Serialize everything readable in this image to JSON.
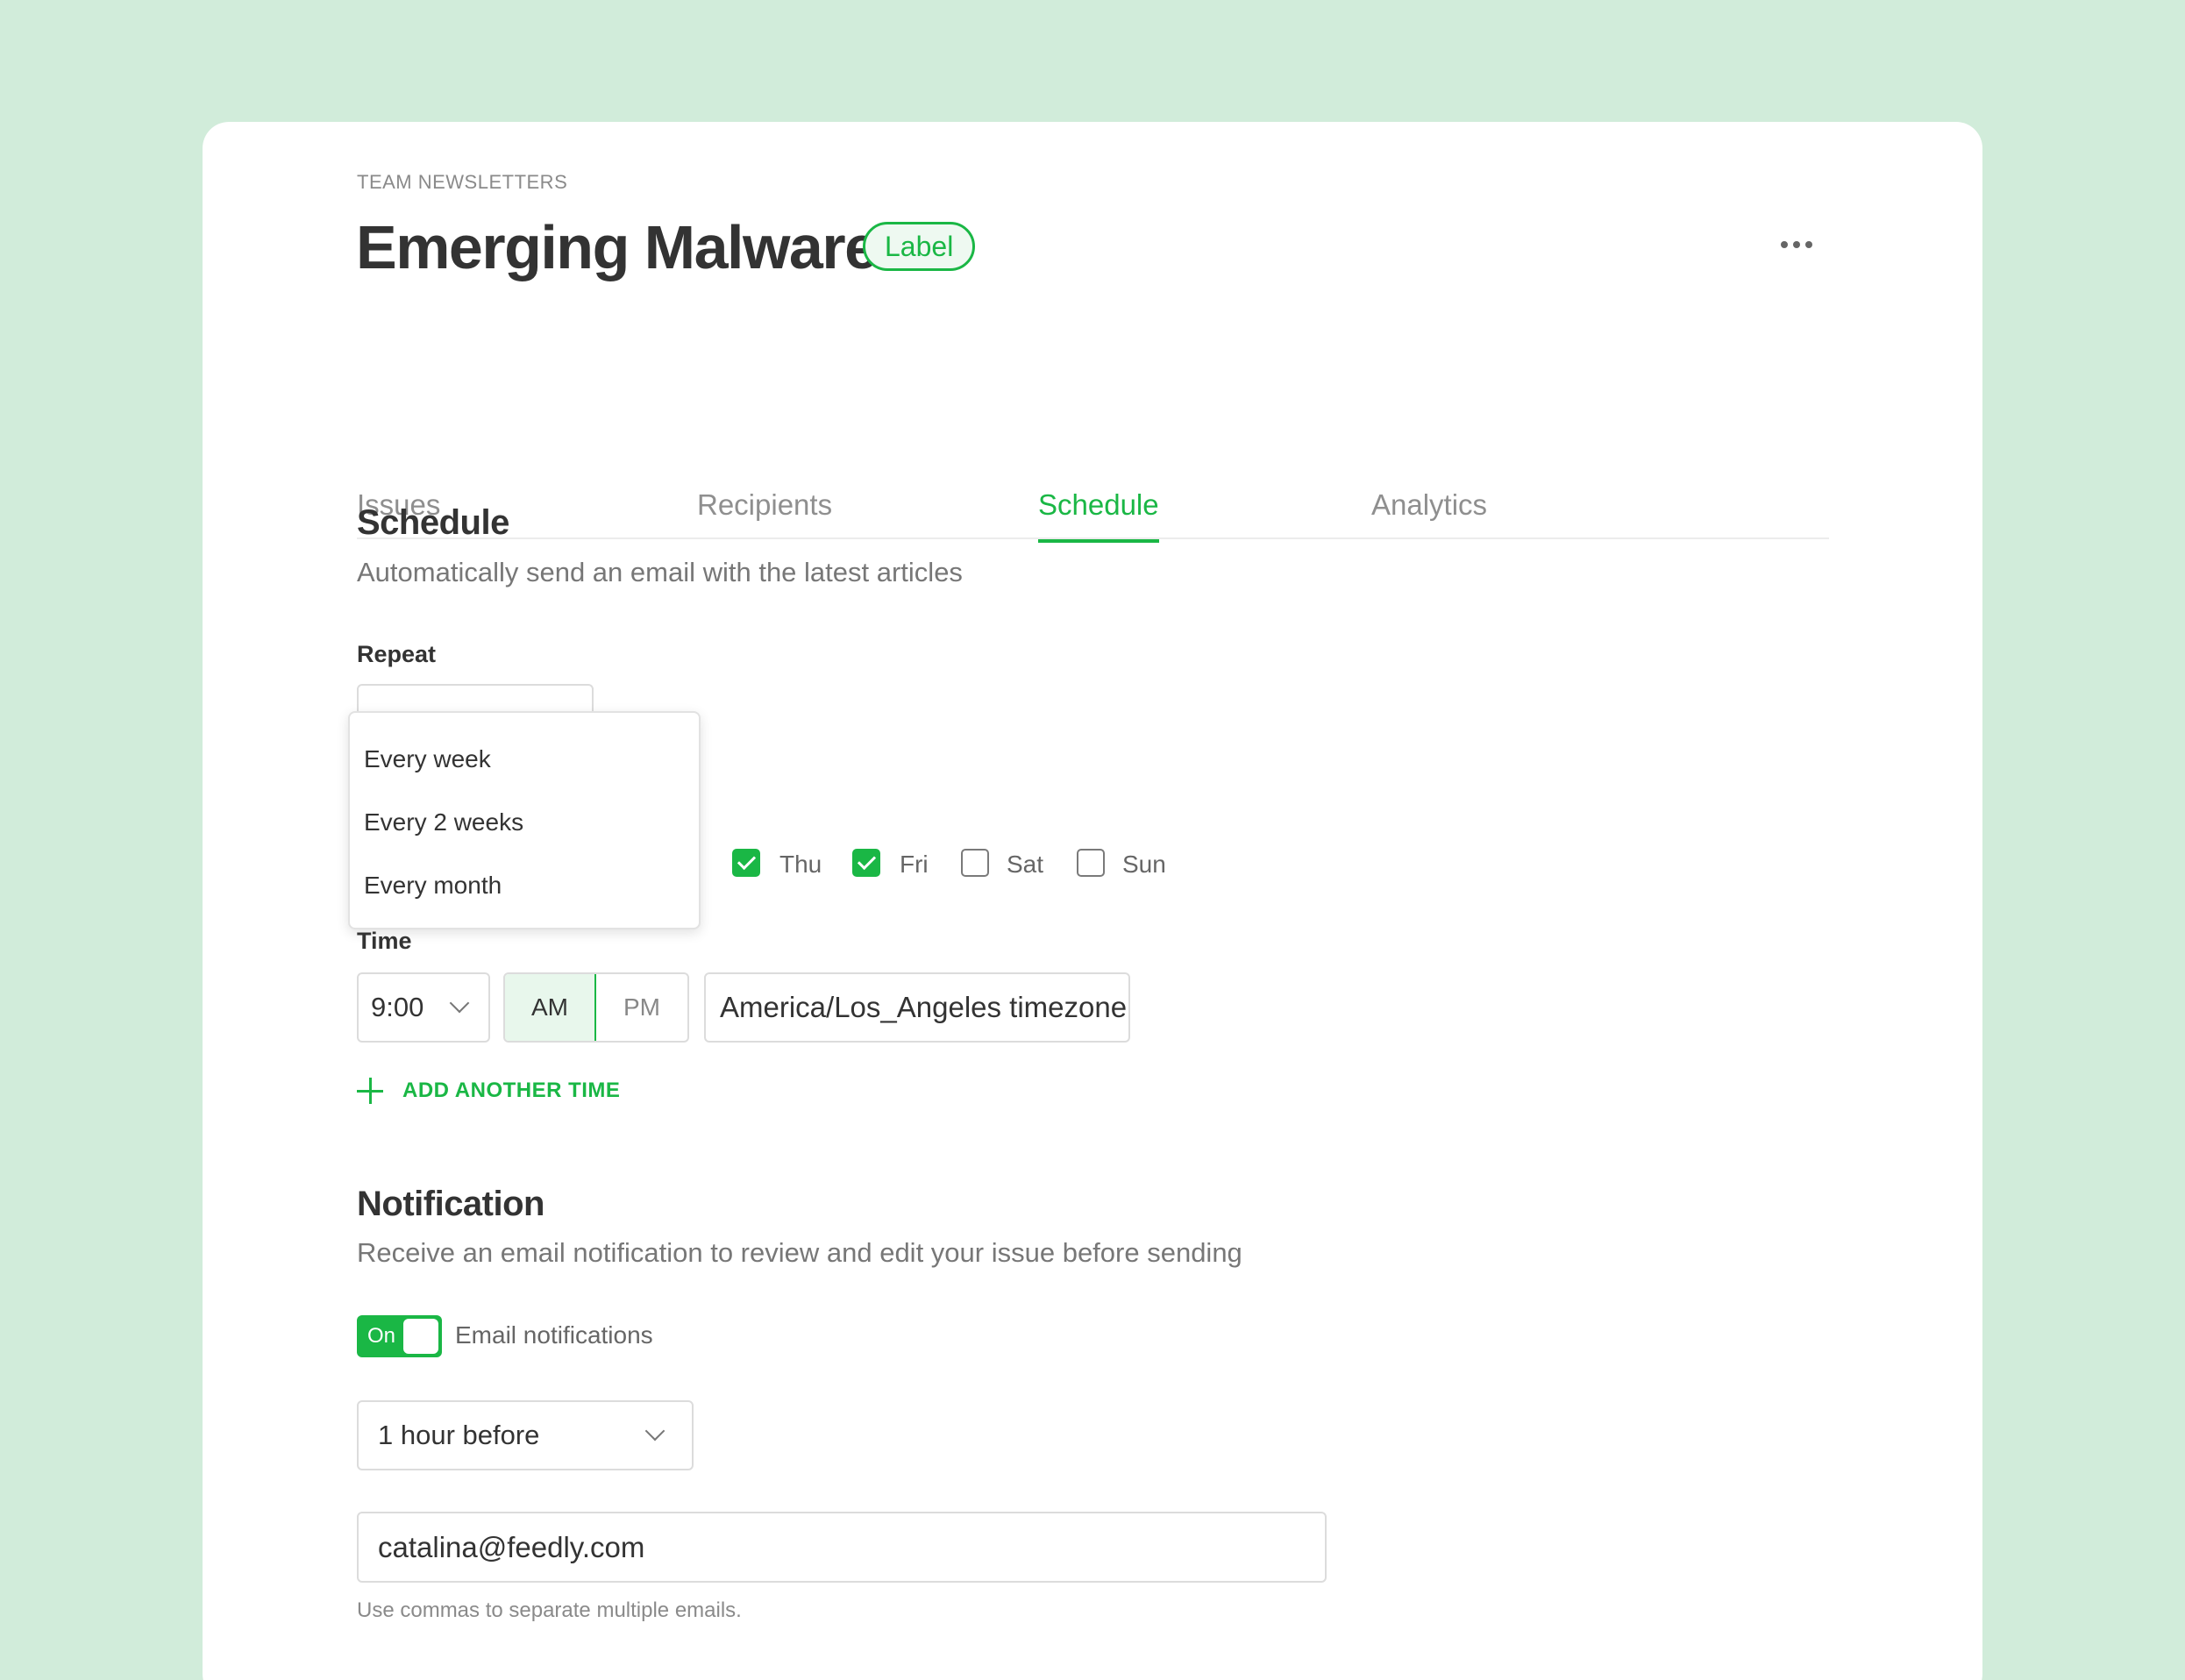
{
  "header": {
    "eyebrow": "TEAM NEWSLETTERS",
    "title": "Emerging Malware",
    "badge": "Label"
  },
  "tabs": [
    {
      "label": "Issues",
      "active": false
    },
    {
      "label": "Recipients",
      "active": false
    },
    {
      "label": "Schedule",
      "active": true
    },
    {
      "label": "Analytics",
      "active": false
    }
  ],
  "schedule": {
    "heading": "Schedule",
    "description": "Automatically send an email with the latest articles",
    "repeat_label": "Repeat",
    "repeat_options": [
      "Every week",
      "Every 2 weeks",
      "Every month"
    ],
    "days": [
      {
        "label": "Thu",
        "checked": true
      },
      {
        "label": "Fri",
        "checked": true
      },
      {
        "label": "Sat",
        "checked": false
      },
      {
        "label": "Sun",
        "checked": false
      }
    ],
    "time_label": "Time",
    "time_value": "9:00",
    "am_label": "AM",
    "pm_label": "PM",
    "selected_period": "AM",
    "timezone": "America/Los_Angeles timezone",
    "add_time_label": "ADD ANOTHER TIME"
  },
  "notification": {
    "heading": "Notification",
    "description": "Receive an email notification to review and edit your issue before sending",
    "toggle_on_text": "On",
    "toggle_label": "Email notifications",
    "lead_time": "1 hour before",
    "email_value": "catalina@feedly.com",
    "hint": "Use commas to separate multiple emails."
  },
  "colors": {
    "accent": "#1ab745",
    "background": "#d1ecda"
  }
}
